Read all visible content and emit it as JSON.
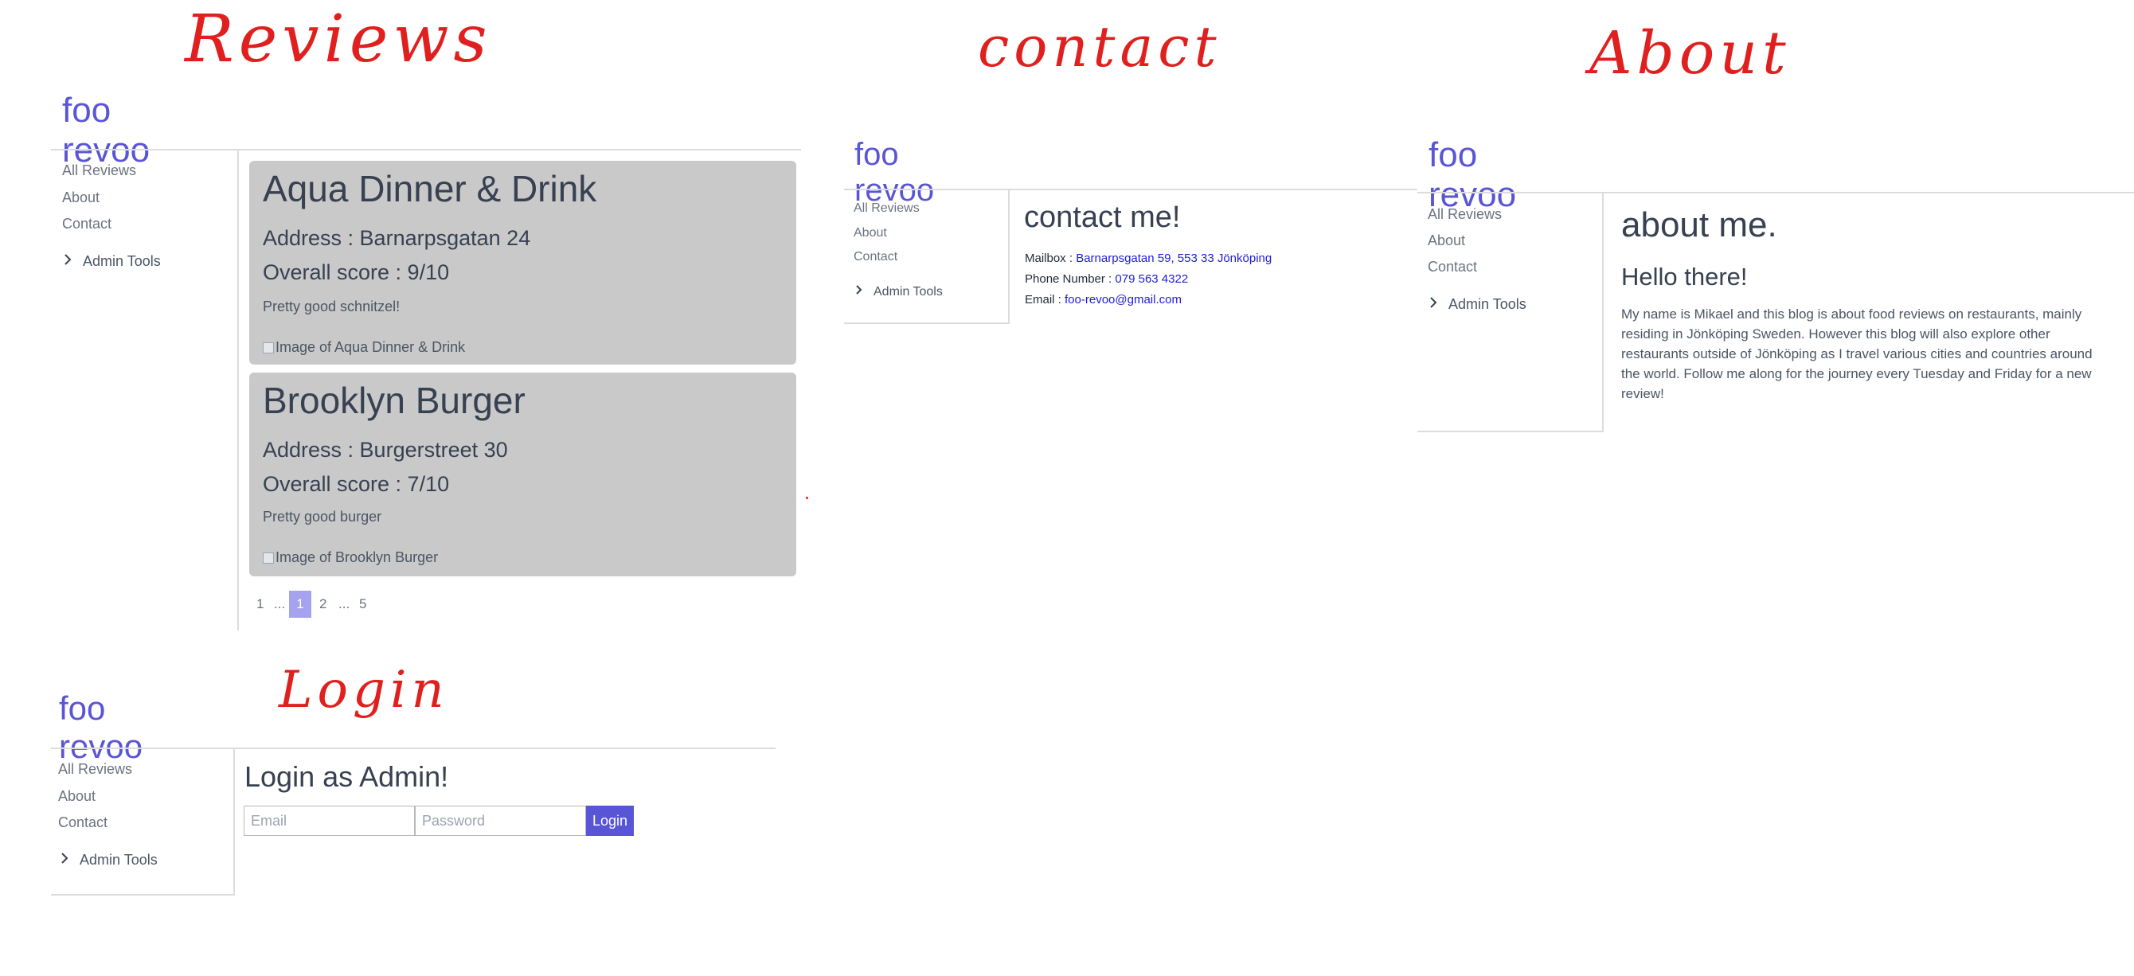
{
  "annotations": {
    "reviews": "Reviews",
    "contact": "contact",
    "about": "About",
    "login": "Login"
  },
  "brand": "foo revoo",
  "sidebar": {
    "items": [
      "All Reviews",
      "About",
      "Contact"
    ],
    "admin_tools": "Admin Tools"
  },
  "reviews_page": {
    "reviews": [
      {
        "name": "Aqua Dinner & Drink",
        "address": "Address : Barnarpsgatan 24",
        "score": "Overall score : 9/10",
        "description": "Pretty good schnitzel!",
        "image_alt": "Image of Aqua Dinner & Drink"
      },
      {
        "name": "Brooklyn Burger",
        "address": "Address : Burgerstreet 30",
        "score": "Overall score : 7/10",
        "description": "Pretty good burger",
        "image_alt": "Image of Brooklyn Burger"
      }
    ],
    "pagination": [
      "1",
      "...",
      "1",
      "2",
      "...",
      "5"
    ],
    "current_page": "1"
  },
  "contact_page": {
    "title": "contact me!",
    "mailbox_label": "Mailbox : ",
    "mailbox_value": "Barnarpsgatan 59, 553 33 Jönköping",
    "phone_label": "Phone Number : ",
    "phone_value": "079 563 4322",
    "email_label": "Email : ",
    "email_value": "foo-revoo@gmail.com"
  },
  "about_page": {
    "title": "about me.",
    "subtitle": "Hello there!",
    "body_lines": [
      "My name is Mikael and this blog is about food reviews on restaurants, mainly",
      "residing in Jönköping Sweden. However this blog will also explore other",
      "restaurants outside of Jönköping as I travel various cities and countries around",
      "the world. Follow me along for the journey every Tuesday and Friday for a new",
      "review!"
    ]
  },
  "login_page": {
    "title": "Login as Admin!",
    "email_placeholder": "Email",
    "password_placeholder": "Password",
    "button_label": "Login"
  },
  "colors": {
    "brand": "#5a55d6",
    "card_bg": "#c9c9c9",
    "annotation": "#e0201e",
    "link": "#1d1dd8",
    "button": "#5855d6"
  }
}
